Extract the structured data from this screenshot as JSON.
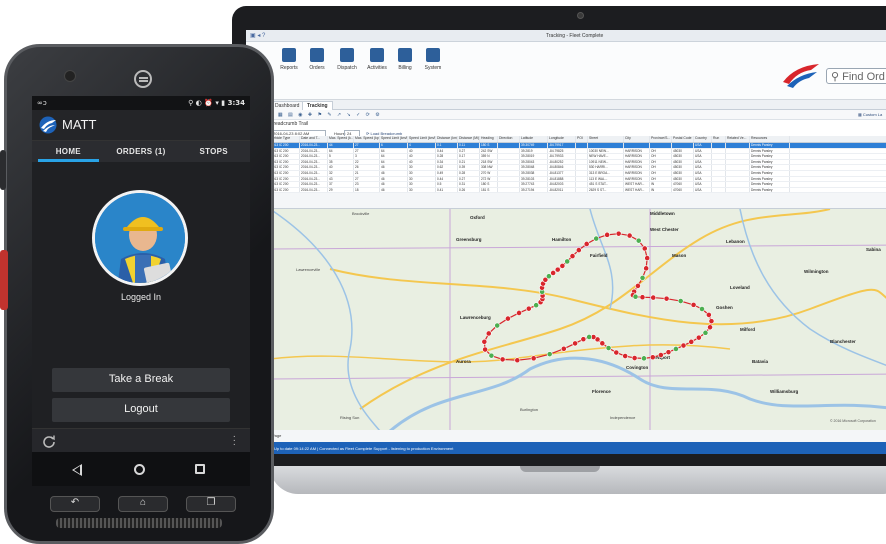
{
  "phone": {
    "status": {
      "left": "∞ɔ",
      "right": "3:34"
    },
    "app_title": "MATT",
    "tabs": [
      {
        "label": "HOME",
        "active": true
      },
      {
        "label": "ORDERS (1)",
        "active": false
      },
      {
        "label": "STOPS",
        "active": false
      }
    ],
    "status_text": "Logged In",
    "buttons": {
      "break": "Take a Break",
      "logout": "Logout"
    },
    "hardware": {
      "back": "↶",
      "home": "⌂",
      "recent": "❐"
    }
  },
  "laptop": {
    "window_title": "Tracking - Fleet Complete",
    "ribbon": [
      {
        "label": "Reports"
      },
      {
        "label": "Orders"
      },
      {
        "label": "Dispatch"
      },
      {
        "label": "Activities"
      },
      {
        "label": "Billing"
      },
      {
        "label": "System"
      }
    ],
    "search_placeholder": "Find Ord",
    "tabs": [
      {
        "label": "Dashboard",
        "active": false
      },
      {
        "label": "Tracking",
        "active": true
      }
    ],
    "custom_link": "Custom La",
    "section_title": "Breadcrumb Trail",
    "filter": {
      "date": "2016-04-23 8:02 AM",
      "hours_label": "Hours:",
      "hours": "24",
      "load_label": "Load Breadcrumb"
    },
    "grid": {
      "columns": [
        "Vehicle Type",
        "Date and T...",
        "Max. Speed (k...",
        "Max. Speed (kph)",
        "Speed Limit (km/h)",
        "Speed Limit (km/h)",
        "Distance (km)",
        "Distance (Mi)",
        "Heading",
        "Direction",
        "Latitude",
        "Longitude",
        "POI",
        "Street",
        "City",
        "Province/S...",
        "Postal Code",
        "Country",
        "Run",
        "Related Ve...",
        "Resources"
      ],
      "rows": [
        [
          "2013 IC 200",
          "2016-04-23...",
          "44",
          "27",
          "6",
          "4",
          "0.1",
          "0.11",
          "180 S",
          "",
          "39.30749",
          "-84.79917",
          "",
          "",
          "",
          "",
          "",
          "USA",
          "",
          "",
          "Dennis Parsley"
        ],
        [
          "2013 IC 200",
          "2016-04-23...",
          "64",
          "27",
          "64",
          "40",
          "0.44",
          "0.27",
          "242 SW",
          "",
          "39.2819",
          "-84.79825",
          "",
          "10030 NEW...",
          "HARRISON",
          "OH",
          "45030",
          "USA",
          "",
          "",
          "Dennis Parsley"
        ],
        [
          "2013 IC 200",
          "2016-04-23...",
          "5",
          "3",
          "64",
          "40",
          "0.28",
          "0.17",
          "359 N",
          "",
          "39.28019",
          "-84.79933",
          "",
          "NEW HAVE...",
          "HARRISON",
          "OH",
          "45030",
          "USA",
          "",
          "",
          "Dennis Parsley"
        ],
        [
          "2013 IC 200",
          "2016-04-23...",
          "35",
          "22",
          "64",
          "40",
          "0.34",
          "0.21",
          "218 SW",
          "",
          "39.28043",
          "-84.80252",
          "",
          "10911 NEW...",
          "HARRISON",
          "OH",
          "45030",
          "USA",
          "",
          "",
          "Dennis Parsley"
        ],
        [
          "2013 IC 200",
          "2016-04-23...",
          "40",
          "26",
          "46",
          "30",
          "0.62",
          "0.39",
          "308 NW",
          "",
          "39.28048",
          "-84.80846",
          "",
          "530 HARRI...",
          "HARRISON",
          "OH",
          "45030",
          "USA",
          "",
          "",
          "Dennis Parsley"
        ],
        [
          "2013 IC 200",
          "2016-04-23...",
          "32",
          "21",
          "46",
          "30",
          "0.49",
          "0.28",
          "270 W",
          "",
          "39.28038",
          "-84.81377",
          "",
          "313 E BROA...",
          "HARRISON",
          "OH",
          "45030",
          "USA",
          "",
          "",
          "Dennis Parsley"
        ],
        [
          "2013 IC 200",
          "2016-04-23...",
          "43",
          "27",
          "46",
          "30",
          "0.44",
          "0.27",
          "272 W",
          "",
          "39.28103",
          "-84.81888",
          "",
          "113 E WAL...",
          "HARRISON",
          "OH",
          "45030",
          "USA",
          "",
          "",
          "Dennis Parsley"
        ],
        [
          "2013 IC 200",
          "2016-04-23...",
          "37",
          "23",
          "46",
          "30",
          "0.5",
          "0.31",
          "180 S",
          "",
          "39.27743",
          "-84.82003",
          "",
          "451 S STAT...",
          "WEST HAR...",
          "IN",
          "47060",
          "USA",
          "",
          "",
          "Dennis Parsley"
        ],
        [
          "2013 IC 200",
          "2016-04-23...",
          "29",
          "18",
          "46",
          "30",
          "0.41",
          "0.26",
          "181 S",
          "",
          "39.27194",
          "-84.82011",
          "",
          "2629 S ST...",
          "WEST HAR...",
          "IN",
          "47060",
          "USA",
          "",
          "",
          "Dennis Parsley"
        ]
      ]
    },
    "map": {
      "cities": [
        "Greensburg",
        "Oxford",
        "Hamilton",
        "West Chester",
        "Mason",
        "Lebanon",
        "Lawrenceburg",
        "Aurora",
        "Florence",
        "Covington",
        "Newport",
        "Milford",
        "Batavia",
        "Loveland",
        "Fairfield",
        "Middletown",
        "Wilmington",
        "Blanchester",
        "Sabina",
        "Goshen",
        "Williamsburg",
        "Lawrenceville",
        "Brookville",
        "Rising Sun",
        "Burlington",
        "Independence"
      ],
      "copyright": "© 2016 Microsoft Corporation"
    },
    "lower_strip": "Page",
    "status_bar": "Up to date 09:14:22 AM | Connected as Fleet Complete Support - listening to production Environment"
  },
  "colors": {
    "accent_blue": "#29a3e6",
    "brand_red": "#d8262c",
    "brand_blue": "#1d62b8",
    "status_bar": "#1d62b8"
  },
  "icons": {
    "sync": "sync-icon",
    "menu": "overflow-menu-icon",
    "search": "search-icon"
  }
}
